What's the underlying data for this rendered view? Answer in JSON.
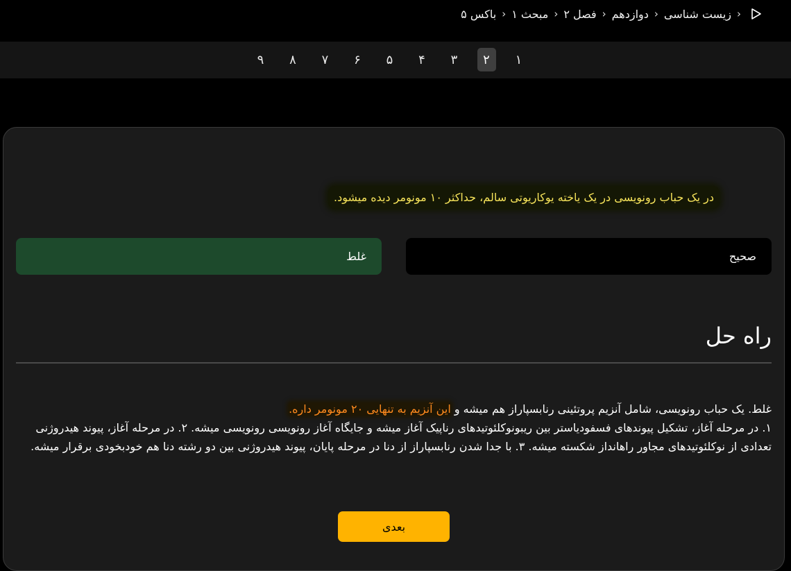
{
  "breadcrumb": {
    "items": [
      "زیست شناسی",
      "دوازدهم",
      "فصل ۲",
      "مبحث ۱",
      "باکس ۵"
    ],
    "play_icon": "play-icon",
    "separator_icon": "chevron-left-icon"
  },
  "pager": {
    "pages": [
      "۱",
      "۲",
      "۳",
      "۴",
      "۵",
      "۶",
      "۷",
      "۸",
      "۹"
    ],
    "active_page": "۲"
  },
  "question": {
    "text": "در یک حباب رونویسی در یک یاخته یوکاریوتی سالم، حداکثر ۱۰ مونومر دیده میشود."
  },
  "options": {
    "true_label": "صحیح",
    "false_label": "غلط",
    "selected": "غلط"
  },
  "solution": {
    "title": "راه حل",
    "line1_part1": "غلط. یک حباب رونویسی، شامل آنزیم پروتئینی رنابسپاراز هم میشه و ",
    "line1_highlight": "این آنزیم به تنهایی ۲۰ مونومر داره.",
    "body": "۱. در مرحله آغاز، تشکیل پیوندهای فسفودیاستر بین ریبونوکلئوتیدهای رناپیک آغاز میشه و جایگاه آغاز رونویسی رونویسی میشه. ۲. در مرحله آغاز، پیوند هیدروژنی تعدادی از نوکلئوتیدهای مجاور راهانداز شکسته میشه. ۳. با جدا شدن رنابسپاراز از دنا در مرحله پایان، پیوند هیدروژنی بین دو رشته دنا هم خودبخودی برقرار میشه."
  },
  "next_button": {
    "label": "بعدی"
  },
  "colors": {
    "background": "#000000",
    "card": "#1b1b1b",
    "question_text": "#f6e35a",
    "selected_option": "#1d4a2c",
    "highlight_text": "#ff8a1e",
    "next_button": "#ffb300"
  }
}
